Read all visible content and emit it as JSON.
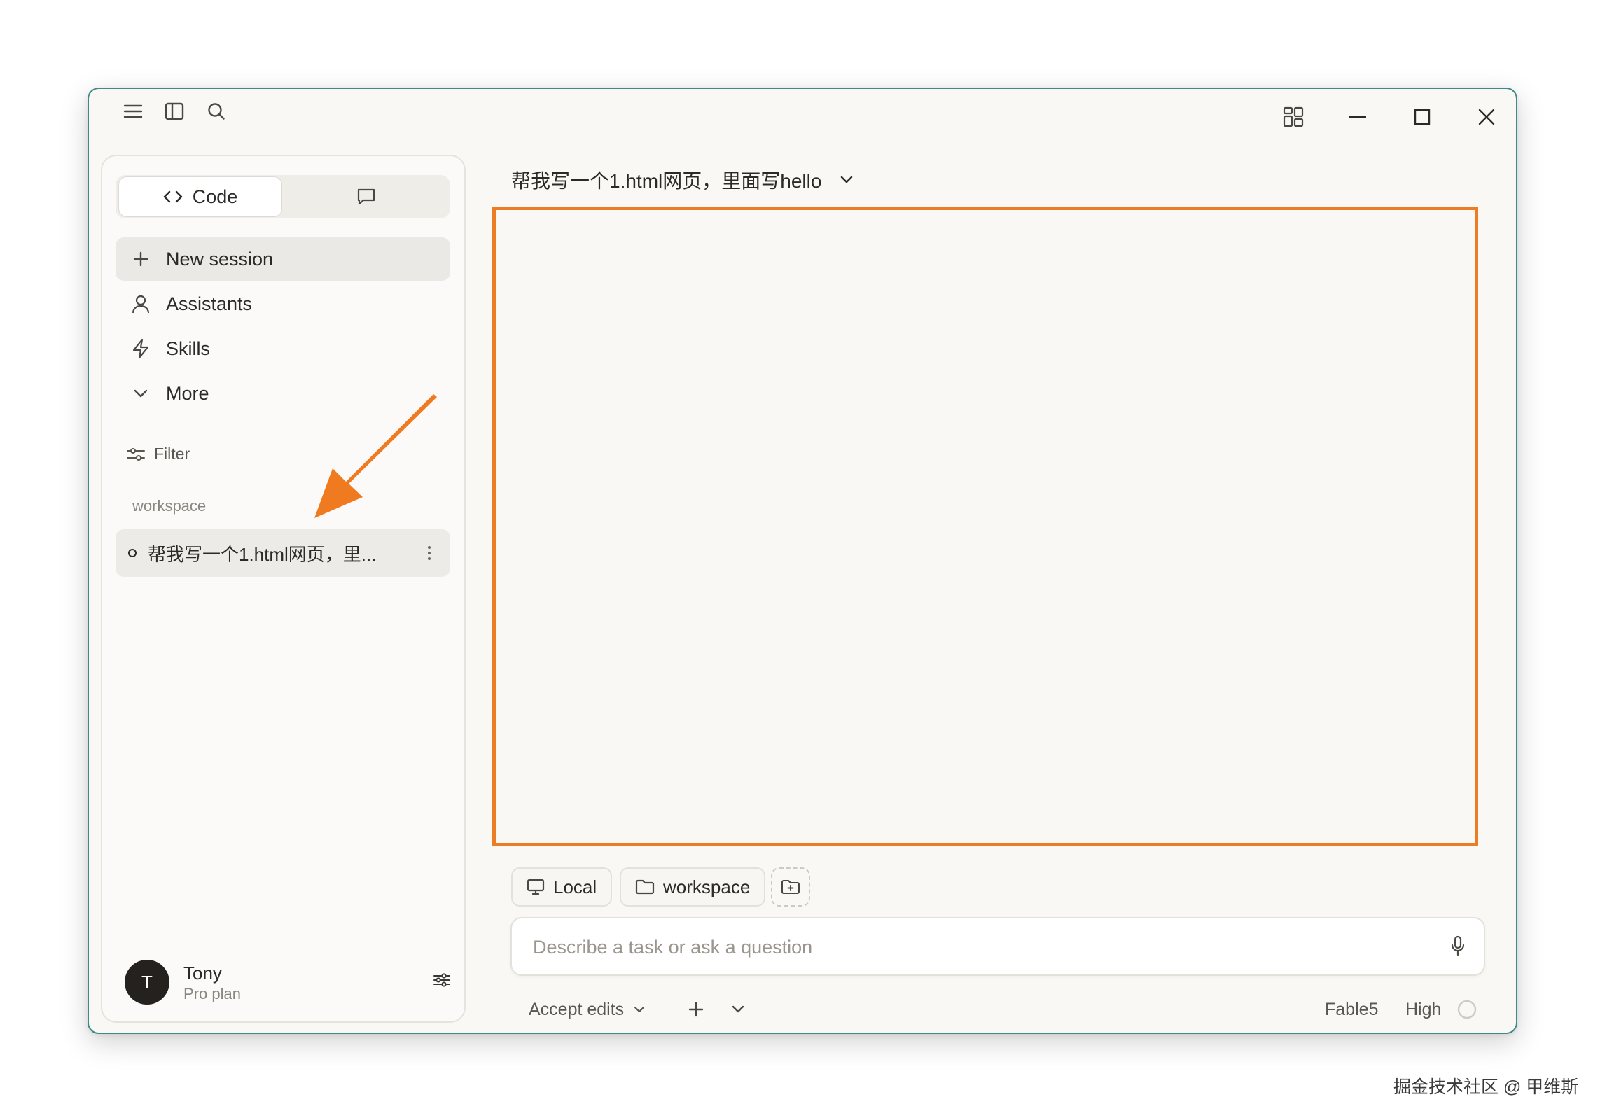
{
  "sidebar": {
    "mode_code_label": "Code",
    "nav": [
      {
        "label": "New session"
      },
      {
        "label": "Assistants"
      },
      {
        "label": "Skills"
      },
      {
        "label": "More"
      }
    ],
    "filter_label": "Filter",
    "section_label": "workspace",
    "session_title": "帮我写一个1.html网页，里..."
  },
  "user": {
    "avatar_initial": "T",
    "name": "Tony",
    "plan": "Pro plan"
  },
  "main": {
    "title": "帮我写一个1.html网页，里面写hello",
    "chips": {
      "local": "Local",
      "workspace": "workspace"
    },
    "prompt_placeholder": "Describe a task or ask a question",
    "footer": {
      "accept_edits": "Accept edits",
      "model": "Fable5",
      "effort": "High"
    }
  },
  "colors": {
    "accent_orange": "#ec7d24",
    "window_border": "#3d8a86",
    "background": "#f9f8f5"
  },
  "watermark": "掘金技术社区 @ 甲维斯"
}
